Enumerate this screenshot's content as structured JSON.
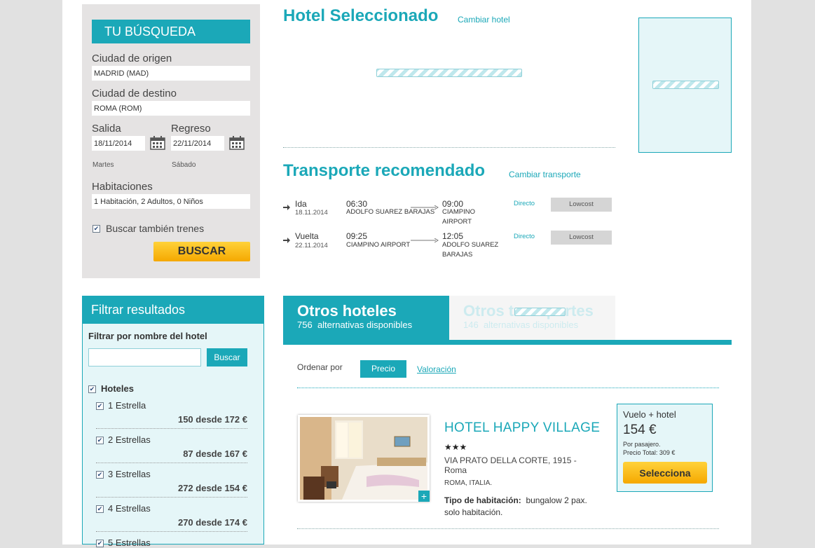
{
  "search": {
    "title": "TU BÚSQUEDA",
    "origin_label": "Ciudad de origen",
    "origin_value": "MADRID (MAD)",
    "dest_label": "Ciudad de destino",
    "dest_value": "ROMA (ROM)",
    "depart_label": "Salida",
    "depart_value": "18/11/2014",
    "depart_day": "Martes",
    "return_label": "Regreso",
    "return_value": "22/11/2014",
    "return_day": "Sábado",
    "rooms_label": "Habitaciones",
    "rooms_value": "1 Habitación, 2 Adultos, 0 Niños",
    "trains_label": "Buscar también trenes",
    "trains_checked": true,
    "search_button": "BUSCAR"
  },
  "hotel_section": {
    "title": "Hotel Seleccionado",
    "change_link": "Cambiar hotel"
  },
  "transport_section": {
    "title": "Transporte recomendado",
    "change_link": "Cambiar transporte",
    "legs": [
      {
        "type": "Ida",
        "date": "18.11.2014",
        "dep_time": "06:30",
        "dep_place": "ADOLFO SUAREZ BARAJAS",
        "arr_time": "09:00",
        "arr_place_1": "CIAMPINO",
        "arr_place_2": "AIRPORT",
        "arr_place_3": "",
        "stops": "Directo",
        "fare": "Lowcost"
      },
      {
        "type": "Vuelta",
        "date": "22.11.2014",
        "dep_time": "09:25",
        "dep_place": "CIAMPINO AIRPORT",
        "arr_time": "12:05",
        "arr_place_1": "ADOLFO SUAREZ",
        "arr_place_2": "BARAJAS",
        "arr_place_3": "",
        "stops": "Directo",
        "fare": "Lowcost"
      }
    ]
  },
  "filter": {
    "title": "Filtrar resultados",
    "name_label": "Filtrar por nombre del hotel",
    "name_placeholder": "",
    "search_button": "Buscar",
    "group_label": "Hoteles",
    "items": [
      {
        "label": "1 Estrella",
        "summary": "150 desde 172 €"
      },
      {
        "label": "2 Estrellas",
        "summary": "87 desde 167 €"
      },
      {
        "label": "3 Estrellas",
        "summary": "272 desde 154 €"
      },
      {
        "label": "4 Estrellas",
        "summary": "270 desde 174 €"
      },
      {
        "label": "5 Estrellas",
        "summary": ""
      }
    ]
  },
  "tabs": {
    "active_title": "Otros hoteles",
    "active_count": "756",
    "active_sub": "alternativas disponibles",
    "inactive_title": "Otros transportes",
    "inactive_count": "146",
    "inactive_sub": "alternativas disponibles"
  },
  "sort": {
    "label": "Ordenar por",
    "price": "Precio",
    "rating": "Valoración"
  },
  "hotel_card": {
    "name": "HOTEL HAPPY VILLAGE",
    "stars": "★★★",
    "address_1": "VIA PRATO DELLA CORTE, 1915 -",
    "address_2": "Roma",
    "city": "ROMA, ITALIA.",
    "room_label": "Tipo de habitación:",
    "room_value": "bungalow 2 pax.",
    "board": "solo habitación.",
    "price_label": "Vuelo + hotel",
    "price": "154 €",
    "per_pax": "Por pasajero.",
    "total": "Precio Total: 309 €",
    "select_button": "Selecciona"
  },
  "colors": {
    "accent": "#1ba8b8",
    "button": "#ffc000"
  }
}
